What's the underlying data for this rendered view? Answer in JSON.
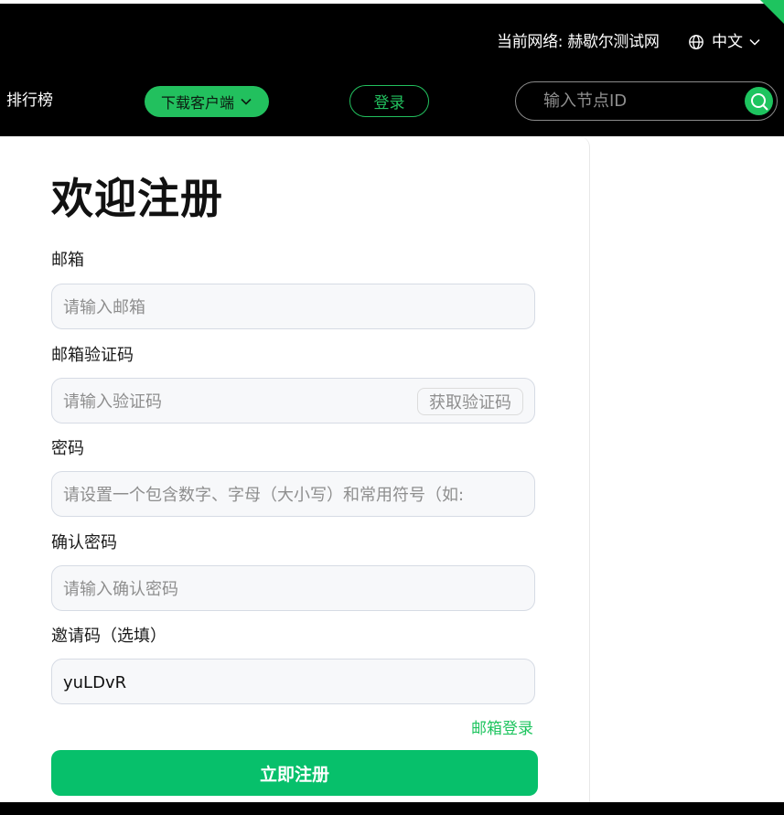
{
  "header": {
    "network_text": "当前网络: 赫歇尔测试网",
    "language": "中文",
    "nav_rank": "排行榜",
    "download_label": "下载客户端",
    "login_label": "登录",
    "search_placeholder": "输入节点ID",
    "accent_color": "#1ec45f"
  },
  "form": {
    "title": "欢迎注册",
    "email_label": "邮箱",
    "email_placeholder": "请输入邮箱",
    "code_label": "邮箱验证码",
    "code_placeholder": "请输入验证码",
    "get_code_label": "获取验证码",
    "password_label": "密码",
    "password_placeholder": "请设置一个包含数字、字母（大小写）和常用符号（如:",
    "confirm_label": "确认密码",
    "confirm_placeholder": "请输入确认密码",
    "invite_label": "邀请码（选填）",
    "invite_value": "yuLDvR",
    "email_login_link": "邮箱登录",
    "submit_label": "立即注册"
  }
}
